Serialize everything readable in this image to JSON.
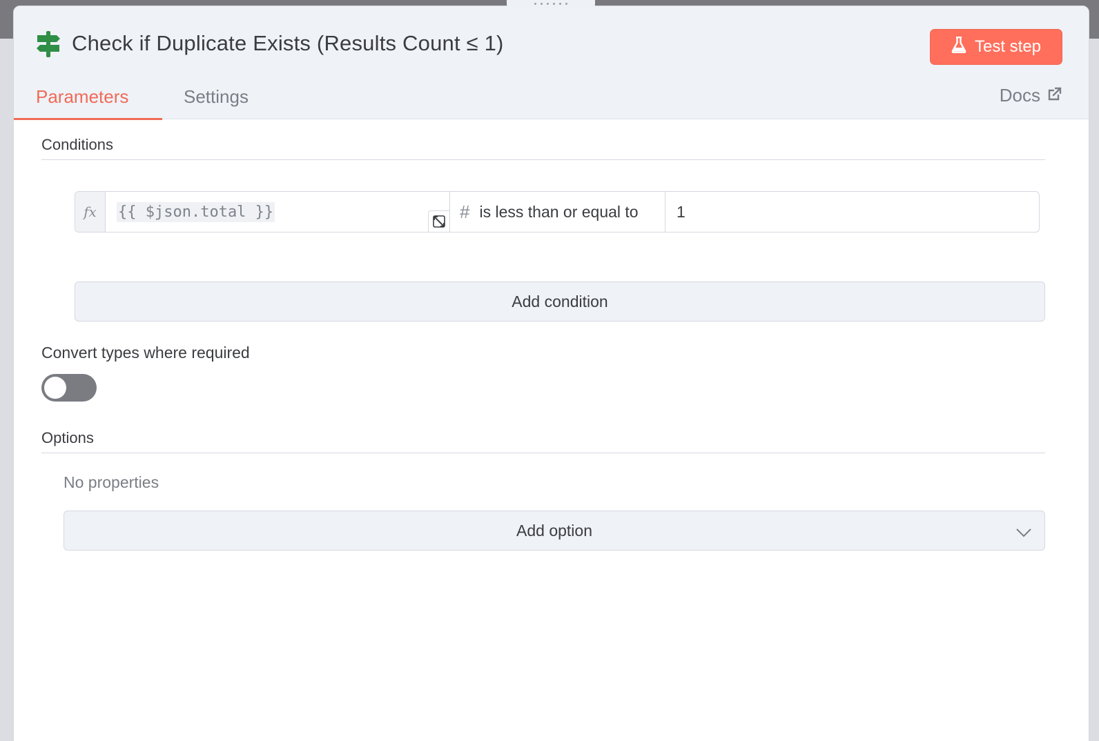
{
  "node": {
    "title": "Check if Duplicate Exists (Results Count ≤ 1)",
    "icon": "signpost-icon",
    "test_button_label": "Test step"
  },
  "tabs": [
    {
      "label": "Parameters",
      "active": true
    },
    {
      "label": "Settings",
      "active": false
    }
  ],
  "docs_label": "Docs",
  "conditions": {
    "title": "Conditions",
    "rows": [
      {
        "fx_label": "fx",
        "expression": "{{ $json.total }}",
        "type_icon": "#",
        "operator": "is less than or equal to",
        "value": "1"
      }
    ],
    "add_label": "Add condition"
  },
  "convert_types": {
    "label": "Convert types where required",
    "enabled": false
  },
  "options": {
    "title": "Options",
    "empty_text": "No properties",
    "add_label": "Add option"
  },
  "colors": {
    "accent": "#ef6b57",
    "button": "#ff6f5c",
    "header_bg": "#eff2f7",
    "icon_green": "#2f8f46"
  }
}
